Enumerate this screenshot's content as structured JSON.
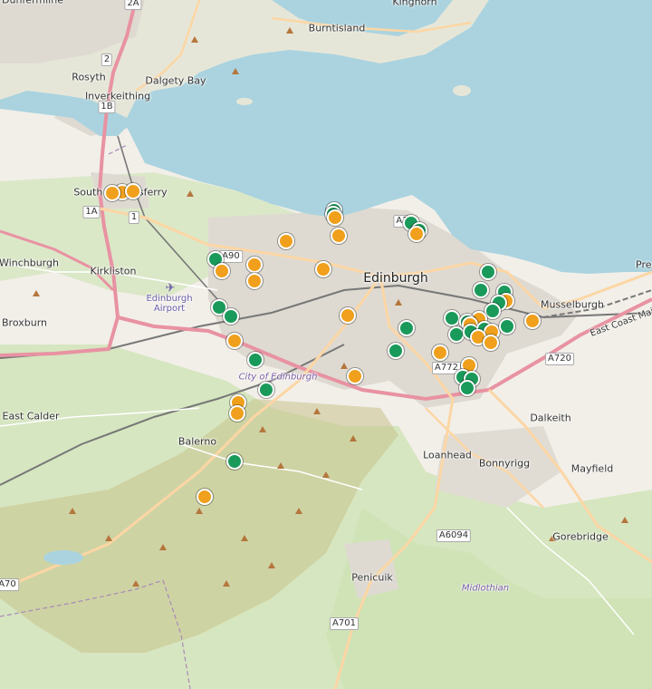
{
  "colors": {
    "water": "#aad3df",
    "land": "#f2efe9",
    "green": "#cde6b8",
    "urban": "#dedad2",
    "moor": "#c9c28c",
    "motorway": "#e892a2",
    "primary": "#fcd6a4",
    "rail": "#777777",
    "marker_green": "#1a9a5a",
    "marker_orange": "#f0a01c"
  },
  "places": [
    {
      "id": "dunfermline",
      "name": "Dunfermline",
      "kind": "town"
    },
    {
      "id": "kinghorn",
      "name": "Kinghorn",
      "kind": "town"
    },
    {
      "id": "burntisland",
      "name": "Burntisland",
      "kind": "town"
    },
    {
      "id": "rosyth",
      "name": "Rosyth",
      "kind": "town"
    },
    {
      "id": "dalgety-bay",
      "name": "Dalgety Bay",
      "kind": "town"
    },
    {
      "id": "inverkeithing",
      "name": "Inverkeithing",
      "kind": "town"
    },
    {
      "id": "south-queensferry",
      "name": "South Queensferry",
      "kind": "town"
    },
    {
      "id": "winchburgh",
      "name": "Winchburgh",
      "kind": "town"
    },
    {
      "id": "kirkliston",
      "name": "Kirkliston",
      "kind": "town"
    },
    {
      "id": "broxburn",
      "name": "Broxburn",
      "kind": "town"
    },
    {
      "id": "edinburgh-airport",
      "name": "Edinburgh Airport",
      "kind": "airport"
    },
    {
      "id": "edinburgh",
      "name": "Edinburgh",
      "kind": "city"
    },
    {
      "id": "musselburgh",
      "name": "Musselburgh",
      "kind": "town"
    },
    {
      "id": "prestonpans",
      "name": "Pres",
      "kind": "town"
    },
    {
      "id": "city-of-edinburgh",
      "name": "City of Edinburgh",
      "kind": "area"
    },
    {
      "id": "east-calder",
      "name": "East Calder",
      "kind": "town"
    },
    {
      "id": "balerno",
      "name": "Balerno",
      "kind": "town"
    },
    {
      "id": "dalkeith",
      "name": "Dalkeith",
      "kind": "town"
    },
    {
      "id": "loanhead",
      "name": "Loanhead",
      "kind": "town"
    },
    {
      "id": "bonnyrigg",
      "name": "Bonnyrigg",
      "kind": "town"
    },
    {
      "id": "mayfield",
      "name": "Mayfield",
      "kind": "town"
    },
    {
      "id": "gorebridge",
      "name": "Gorebridge",
      "kind": "town"
    },
    {
      "id": "penicuik",
      "name": "Penicuik",
      "kind": "town"
    },
    {
      "id": "midlothian",
      "name": "Midlothian",
      "kind": "area"
    },
    {
      "id": "east-coast-main",
      "name": "East Coast Main",
      "kind": "rail"
    }
  ],
  "road_shields": [
    {
      "id": "a90",
      "text": "A90"
    },
    {
      "id": "a772",
      "text": "A772"
    },
    {
      "id": "a720",
      "text": "A720"
    },
    {
      "id": "a6094",
      "text": "A6094"
    },
    {
      "id": "a701",
      "text": "A701"
    },
    {
      "id": "a70",
      "text": "A70"
    },
    {
      "id": "a1-north",
      "text": "A1"
    },
    {
      "id": "m2a",
      "text": "2A"
    },
    {
      "id": "m2",
      "text": "2"
    },
    {
      "id": "m1b",
      "text": "1B"
    },
    {
      "id": "m1a",
      "text": "1A"
    },
    {
      "id": "m1",
      "text": "1"
    }
  ],
  "markers": [
    {
      "color": "orange"
    },
    {
      "color": "orange"
    },
    {
      "color": "orange"
    },
    {
      "color": "green"
    },
    {
      "color": "green"
    },
    {
      "color": "orange"
    },
    {
      "color": "orange"
    },
    {
      "color": "orange"
    },
    {
      "color": "green"
    },
    {
      "color": "green"
    },
    {
      "color": "orange"
    },
    {
      "color": "orange"
    },
    {
      "color": "orange"
    },
    {
      "color": "green"
    },
    {
      "color": "orange"
    },
    {
      "color": "orange"
    },
    {
      "color": "green"
    },
    {
      "color": "green"
    },
    {
      "color": "orange"
    },
    {
      "color": "orange"
    },
    {
      "color": "green"
    },
    {
      "color": "green"
    },
    {
      "color": "orange"
    },
    {
      "color": "orange"
    },
    {
      "color": "green"
    },
    {
      "color": "orange"
    },
    {
      "color": "green"
    },
    {
      "color": "green"
    },
    {
      "color": "green"
    },
    {
      "color": "orange"
    },
    {
      "color": "green"
    },
    {
      "color": "green"
    },
    {
      "color": "orange"
    },
    {
      "color": "green"
    },
    {
      "color": "green"
    },
    {
      "color": "orange"
    },
    {
      "color": "green"
    },
    {
      "color": "green"
    },
    {
      "color": "green"
    },
    {
      "color": "orange"
    },
    {
      "color": "green"
    },
    {
      "color": "orange"
    },
    {
      "color": "orange"
    },
    {
      "color": "orange"
    },
    {
      "color": "green"
    },
    {
      "color": "green"
    },
    {
      "color": "orange"
    },
    {
      "color": "orange"
    },
    {
      "color": "orange"
    },
    {
      "color": "green"
    },
    {
      "color": "green"
    },
    {
      "color": "green"
    }
  ]
}
